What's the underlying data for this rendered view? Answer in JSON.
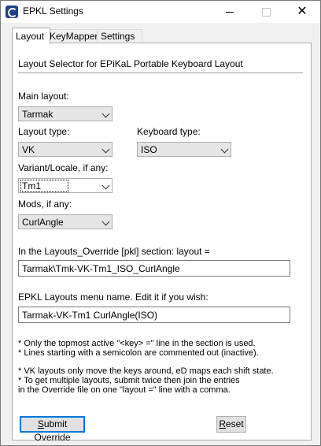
{
  "window": {
    "title": "EPKL Settings"
  },
  "tabs": [
    {
      "label": "Layout",
      "active": true
    },
    {
      "label": "KeyMapper",
      "active": false
    },
    {
      "label": "Settings",
      "active": false
    }
  ],
  "layout_tab": {
    "heading": "Layout Selector for EPiKaL Portable Keyboard Layout",
    "main_layout": {
      "label": "Main layout:",
      "value": "Tarmak"
    },
    "layout_type": {
      "label": "Layout type:",
      "value": "VK"
    },
    "keyboard_type": {
      "label": "Keyboard type:",
      "value": "ISO"
    },
    "variant": {
      "label": "Variant/Locale, if any:",
      "value": "Tm1"
    },
    "mods": {
      "label": "Mods, if any:",
      "value": "CurlAngle"
    },
    "override": {
      "label": "In the Layouts_Override [pkl] section: layout =",
      "value": "Tarmak\\Tmk-VK-Tm1_ISO_CurlAngle"
    },
    "menu_name": {
      "label": "EPKL Layouts menu name. Edit it if you wish:",
      "value": "Tarmak-VK-Tm1 CurlAngle(ISO)"
    },
    "notes": [
      "* Only the topmost active \"<key> =\" line in the section is used.",
      "* Lines starting with a semicolon are commented out (inactive).",
      "* VK layouts only move the keys around, eD maps each shift state.",
      "* To get multiple layouts, submit twice then join the entries",
      "   in the Override file on one \"layout =\" line with a comma."
    ],
    "submit_button": {
      "pre": "",
      "accel": "S",
      "post": "ubmit Override"
    },
    "reset_button": {
      "pre": "",
      "accel": "R",
      "post": "eset"
    }
  }
}
